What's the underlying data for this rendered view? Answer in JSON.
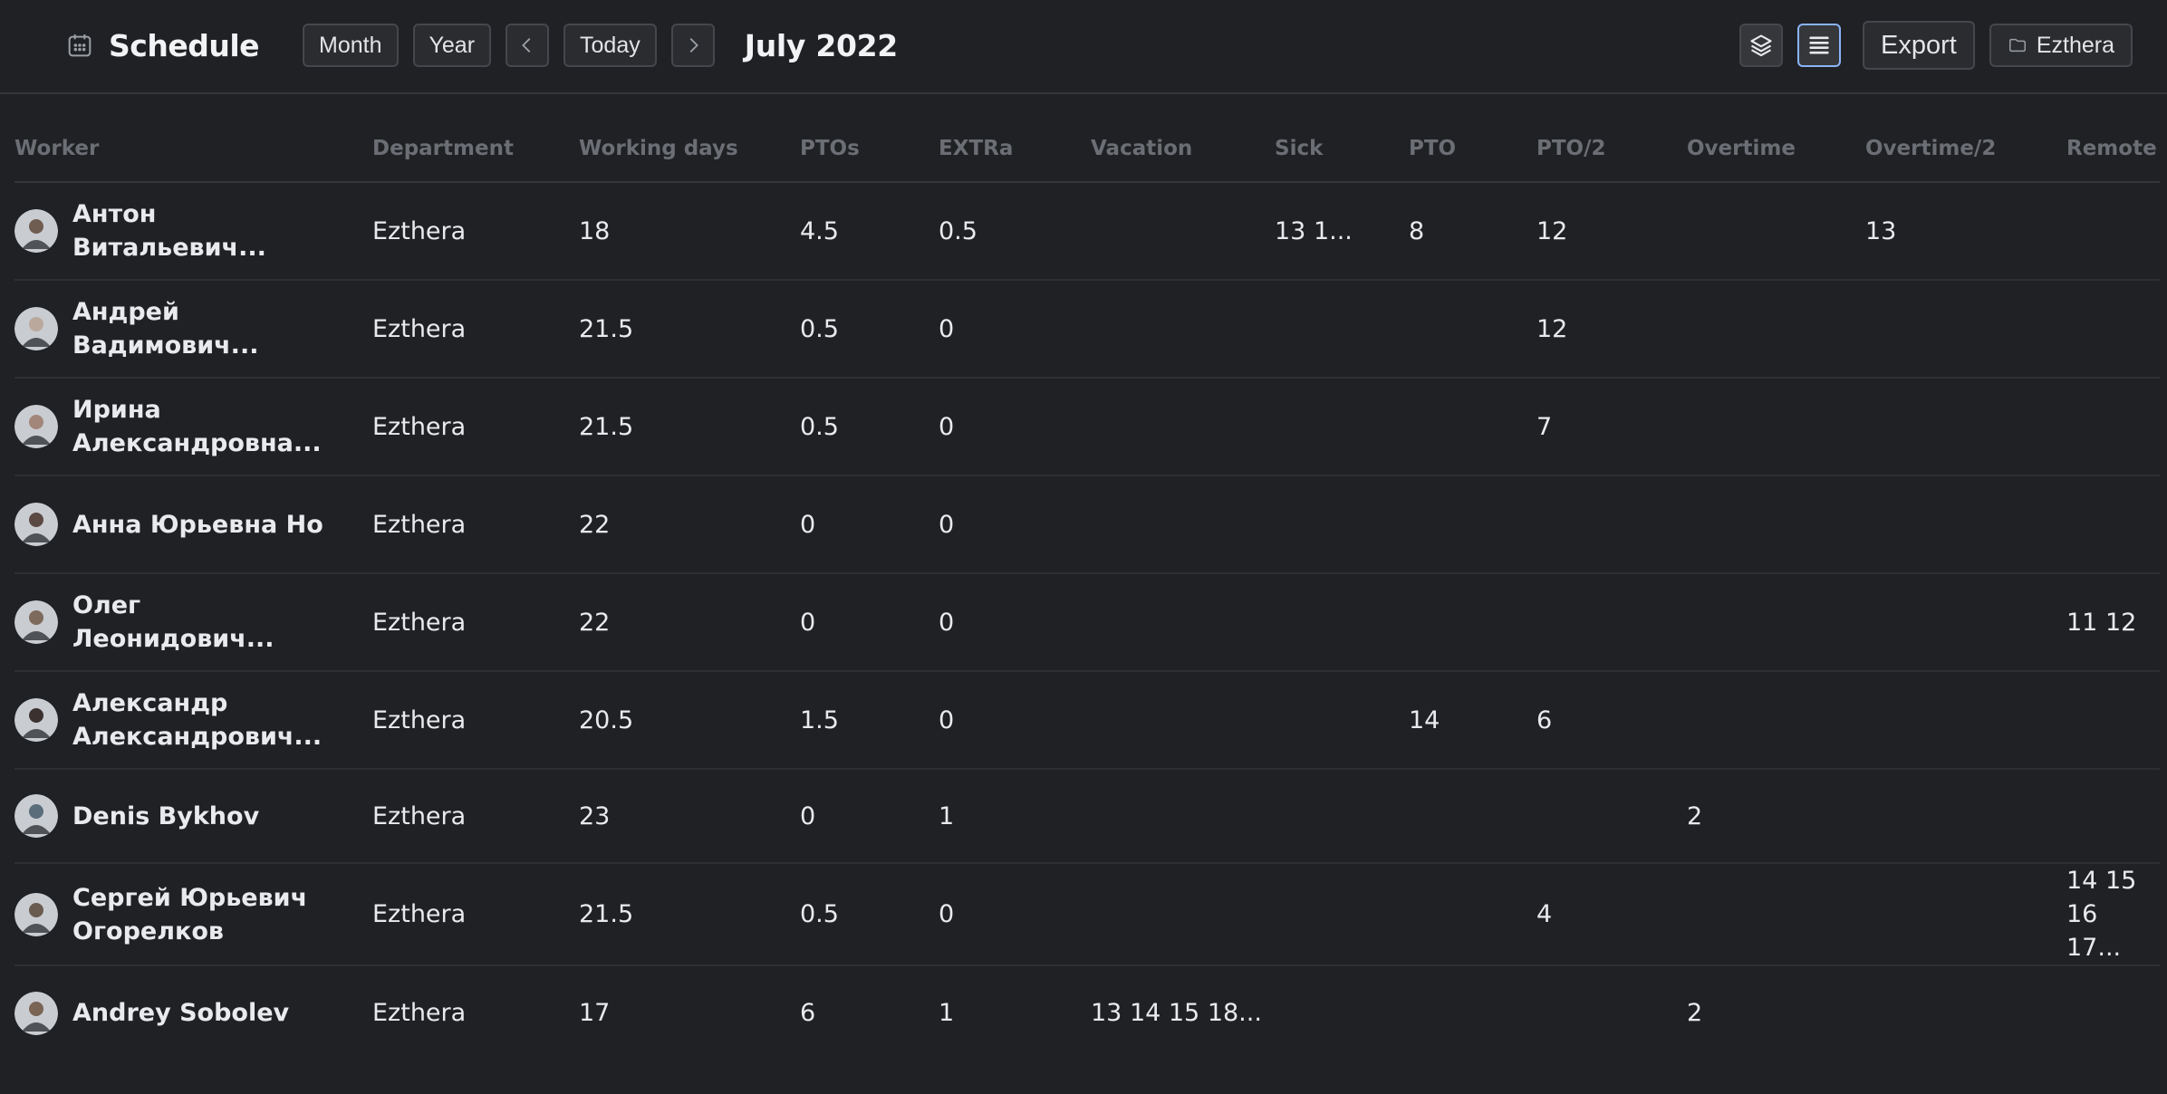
{
  "toolbar": {
    "title": "Schedule",
    "month_label": "Month",
    "year_label": "Year",
    "today_label": "Today",
    "current_period": "July 2022",
    "export_label": "Export",
    "workspace_label": "Ezthera",
    "icons": {
      "calendar": "calendar-icon",
      "prev": "chevron-left-icon",
      "next": "chevron-right-icon",
      "layers": "layers-icon",
      "list": "list-icon",
      "folder": "folder-icon"
    },
    "accent": "#8ab4f8"
  },
  "table": {
    "columns": [
      "Worker",
      "Department",
      "Working days",
      "PTOs",
      "EXTRa",
      "Vacation",
      "Sick",
      "PTO",
      "PTO/2",
      "Overtime",
      "Overtime/2",
      "Remote"
    ],
    "rows": [
      {
        "worker": "Антон Витальевич...",
        "department": "Ezthera",
        "working_days": "18",
        "ptos": "4.5",
        "extra": "0.5",
        "vacation": "",
        "sick": "13 1...",
        "pto": "8",
        "pto2": "12",
        "overtime": "",
        "overtime2": "13",
        "remote": ""
      },
      {
        "worker": "Андрей Вадимович...",
        "department": "Ezthera",
        "working_days": "21.5",
        "ptos": "0.5",
        "extra": "0",
        "vacation": "",
        "sick": "",
        "pto": "",
        "pto2": "12",
        "overtime": "",
        "overtime2": "",
        "remote": ""
      },
      {
        "worker": "Ирина Александровна...",
        "department": "Ezthera",
        "working_days": "21.5",
        "ptos": "0.5",
        "extra": "0",
        "vacation": "",
        "sick": "",
        "pto": "",
        "pto2": "7",
        "overtime": "",
        "overtime2": "",
        "remote": ""
      },
      {
        "worker": "Анна Юрьевна Но",
        "department": "Ezthera",
        "working_days": "22",
        "ptos": "0",
        "extra": "0",
        "vacation": "",
        "sick": "",
        "pto": "",
        "pto2": "",
        "overtime": "",
        "overtime2": "",
        "remote": ""
      },
      {
        "worker": "Олег Леонидович...",
        "department": "Ezthera",
        "working_days": "22",
        "ptos": "0",
        "extra": "0",
        "vacation": "",
        "sick": "",
        "pto": "",
        "pto2": "",
        "overtime": "",
        "overtime2": "",
        "remote": "11 12"
      },
      {
        "worker": "Александр Александрович...",
        "department": "Ezthera",
        "working_days": "20.5",
        "ptos": "1.5",
        "extra": "0",
        "vacation": "",
        "sick": "",
        "pto": "14",
        "pto2": "6",
        "overtime": "",
        "overtime2": "",
        "remote": ""
      },
      {
        "worker": "Denis Bykhov",
        "department": "Ezthera",
        "working_days": "23",
        "ptos": "0",
        "extra": "1",
        "vacation": "",
        "sick": "",
        "pto": "",
        "pto2": "",
        "overtime": "2",
        "overtime2": "",
        "remote": ""
      },
      {
        "worker": "Сергей Юрьевич Огорелков",
        "department": "Ezthera",
        "working_days": "21.5",
        "ptos": "0.5",
        "extra": "0",
        "vacation": "",
        "sick": "",
        "pto": "",
        "pto2": "4",
        "overtime": "",
        "overtime2": "",
        "remote": "14 15 16 17..."
      },
      {
        "worker": "Andrey Sobolev",
        "department": "Ezthera",
        "working_days": "17",
        "ptos": "6",
        "extra": "1",
        "vacation": "13 14 15 18...",
        "sick": "",
        "pto": "",
        "pto2": "",
        "overtime": "2",
        "overtime2": "",
        "remote": ""
      }
    ]
  }
}
